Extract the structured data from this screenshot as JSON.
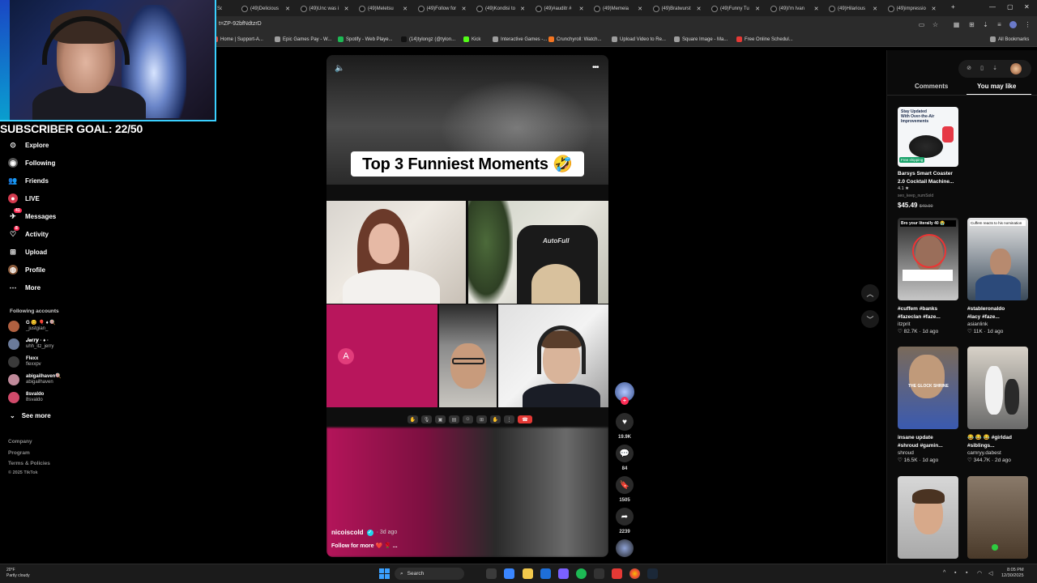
{
  "browser": {
    "tabs": [
      {
        "label": "(49)Delicious"
      },
      {
        "label": "(49)Unc was i"
      },
      {
        "label": "(49)Meletsu"
      },
      {
        "label": "(49)Follow for"
      },
      {
        "label": "(49)Kondisi to"
      },
      {
        "label": "(49)#auditr #"
      },
      {
        "label": "(49)Memeia"
      },
      {
        "label": "(49)Bratwurst"
      },
      {
        "label": "(49)Funny Tu"
      },
      {
        "label": "(49)I'm Ivan"
      },
      {
        "label": "(49)Hilarious"
      },
      {
        "label": "(49)impressio"
      }
    ],
    "first_tab_partial": "Sc",
    "url": "t=ZP-92bfNdtzrD",
    "bookmarks": [
      {
        "label": "Home | Support-A...",
        "color": "#e74c3c"
      },
      {
        "label": "Epic Games Pay - W...",
        "color": "#9e9e9e"
      },
      {
        "label": "Spotify - Web Playe...",
        "color": "#1db954"
      },
      {
        "label": "(14)tylongz (@tylon...",
        "color": "#111111"
      },
      {
        "label": "Kick",
        "color": "#53fc18"
      },
      {
        "label": "Interactive Games -...",
        "color": "#9e9e9e"
      },
      {
        "label": "Crunchyroll: Watch...",
        "color": "#f47521"
      },
      {
        "label": "Upload Video to Re...",
        "color": "#9e9e9e"
      },
      {
        "label": "Square Image - Ma...",
        "color": "#9e9e9e"
      },
      {
        "label": "Free Online Schedul...",
        "color": "#e53935"
      }
    ],
    "all_bookmarks": "All Bookmarks"
  },
  "overlay": {
    "subscriber_goal": "SUBSCRIBER GOAL: 22/50"
  },
  "nav": {
    "items": [
      {
        "label": "Explore",
        "icon": "compass-icon",
        "badge": ""
      },
      {
        "label": "Following",
        "icon": "following-icon",
        "badge": ""
      },
      {
        "label": "Friends",
        "icon": "friends-icon",
        "badge": ""
      },
      {
        "label": "LIVE",
        "icon": "live-icon",
        "badge": ""
      },
      {
        "label": "Messages",
        "icon": "messages-icon",
        "badge": "41"
      },
      {
        "label": "Activity",
        "icon": "activity-icon",
        "badge": "8"
      },
      {
        "label": "Upload",
        "icon": "upload-icon",
        "badge": ""
      },
      {
        "label": "Profile",
        "icon": "profile-icon",
        "badge": ""
      },
      {
        "label": "More",
        "icon": "more-icon",
        "badge": ""
      }
    ],
    "following_header": "Following accounts",
    "accounts": [
      {
        "name": "G 😊 🎈 ♦ 🍭",
        "username": "_justgian_"
      },
      {
        "name": "𝑱𝒆𝒓𝒓𝒚 · ♦ ·",
        "username": "uhh_itz_jerry"
      },
      {
        "name": "Flexx",
        "username": "flexxpv"
      },
      {
        "name": "abigailhaven🍭",
        "username": "abigailhaven"
      },
      {
        "name": "8svaldo",
        "username": "8svaldo"
      }
    ],
    "see_more": "See more",
    "footer": [
      "Company",
      "Program",
      "Terms & Policies",
      "© 2025 TikTok"
    ]
  },
  "video": {
    "caption": "Top 3 Funniest Moments 🤣",
    "chair_brand": "AutoFull",
    "tile_avatar_letter": "A",
    "author": "nicoiscold",
    "posted_ago": "· 3d ago",
    "description": "Follow for more ❤️ 🌹 ...",
    "likes": "19.9K",
    "comments": "84",
    "saves": "1505",
    "shares": "2239"
  },
  "right_panel": {
    "tabs": [
      "Comments",
      "You may like"
    ],
    "active_tab": "You may like",
    "cards": [
      {
        "title": "Barsys Smart Coaster",
        "line2": "2.0 Cocktail Machine...",
        "line3": "4.1 ★",
        "line4": "seo_keep_numSold",
        "price": "$45.49",
        "old_price": "$49.99",
        "thumb_text": "Stay Updated With Over-the-Air Improvements",
        "ship": "Free shipping"
      },
      {
        "title": "#cuffem #banks",
        "line2": "#fazeclan #faze...",
        "line3": "itzprit",
        "stats": "♡ 82.7K · 1d ago",
        "thumb_text": "Bro your literally 40 😭"
      },
      {
        "title": "#stableronaldo",
        "line2": "#lacy #faze...",
        "line3": "asianlink",
        "stats": "♡ 11K · 1d ago",
        "thumb_text": "Cuffem reacts to his nomination"
      },
      {
        "title": "insane update",
        "line2": "#shroud #gamin...",
        "line3": "shroud",
        "stats": "♡ 16.5K · 1d ago",
        "thumb_text": "THE GLOCK SHRINE"
      },
      {
        "title": "😂 😂 😂 #girldad",
        "line2": "#siblings...",
        "line3": "camryy.dabest",
        "stats": "♡ 344.7K · 2d ago",
        "thumb_text": ""
      }
    ]
  },
  "taskbar": {
    "weather_temp": "20°F",
    "weather_desc": "Partly cloudy",
    "search": "Search",
    "time": "8:05 PM",
    "date": "12/30/2025"
  }
}
